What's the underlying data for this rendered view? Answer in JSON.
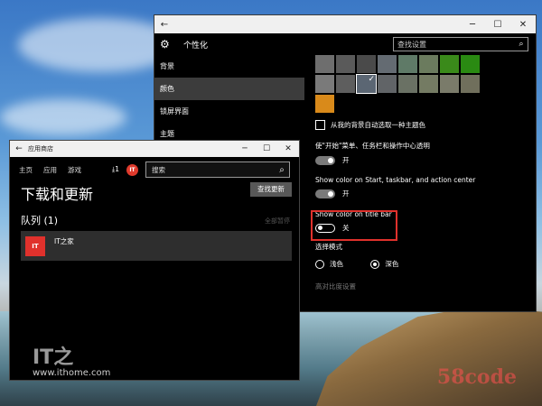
{
  "settings": {
    "title": "个性化",
    "search_placeholder": "查找设置",
    "nav": [
      {
        "label": "背景",
        "active": false
      },
      {
        "label": "颜色",
        "active": true
      },
      {
        "label": "锁屏界面",
        "active": false
      },
      {
        "label": "主题",
        "active": false
      }
    ],
    "swatches": [
      "#6e6e6e",
      "#5a5a5a",
      "#4a4a4a",
      "#646b72",
      "#5f7a67",
      "#6b7b5e",
      "#3a8a1a",
      "#2a8a12",
      "#7a7a7a",
      "#5e5e5e",
      "#5b6673",
      "#616467",
      "#6a7164",
      "#747b63",
      "#7a7b6a",
      "#706f5c",
      "#d98a1a"
    ],
    "selected_swatch": 10,
    "auto_pick_label": "从我的背景自动选取一种主题色",
    "start_transparent_label": "使\"开始\"菜单、任务栏和操作中心透明",
    "start_transparent_value": "开",
    "show_color_start_label": "Show color on Start, taskbar, and action center",
    "show_color_start_value": "开",
    "show_color_title_label": "Show color on title bar",
    "show_color_title_value": "关",
    "mode_label": "选择模式",
    "mode_light": "浅色",
    "mode_dark": "深色",
    "high_contrast": "高对比度设置"
  },
  "store": {
    "window_title": "应用商店",
    "nav": [
      "主页",
      "应用",
      "游戏"
    ],
    "download_count": "1",
    "avatar_text": "IT",
    "search_placeholder": "搜索",
    "heading": "下载和更新",
    "check_updates": "查找更新",
    "queue": "队列 (1)",
    "clear_all": "全部暂停",
    "item_icon_text": "IT",
    "item_name": "IT之家"
  },
  "watermark": {
    "logo": "IT之",
    "url": "www.ithome.com",
    "corner": "58code"
  }
}
